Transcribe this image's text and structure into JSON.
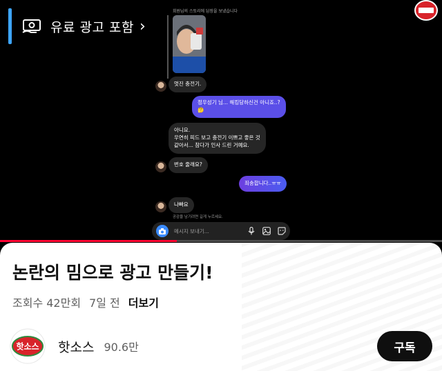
{
  "ad_tag": {
    "label": "유료 광고 포함",
    "chevron": "›"
  },
  "dm": {
    "story_note": "회원님의 스토리에 답장을 보냈습니다",
    "messages": [
      "멋진 충전기.",
      "정우성기 님... 해킹당하신건 아니죠..?",
      "🤔",
      "아니요.",
      "우연히 피드 보고 충전기 이쁘고 좋은 것",
      "같아서... 참다가 인사 드린 거예요.",
      "번호 줄래요?",
      "죄송합니다..ㅠㅠ",
      "나빠요"
    ],
    "system_note": "공감을 남기려면 길게 누르세요.",
    "composer_placeholder": "메시지 보내기..."
  },
  "video": {
    "progress": 0.4
  },
  "info": {
    "title": "논란의 밈으로 광고 만들기!",
    "views": "조회수 42만회",
    "age": "7일 전",
    "more": "더보기",
    "channel_name": "핫소스",
    "subscribers": "90.6만",
    "subscribe_label": "구독",
    "logo_text": "핫소스"
  },
  "colors": {
    "accent_blue": "#3ea6ff",
    "progress_red": "#ff0033",
    "bubble_purple": "#5b4fe8",
    "logo_red": "#d8232a"
  }
}
